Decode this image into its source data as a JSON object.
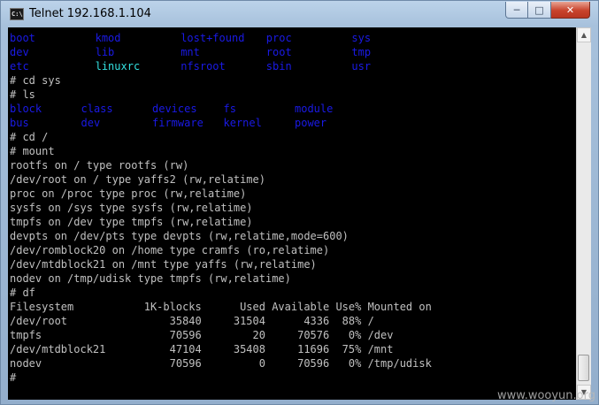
{
  "window": {
    "title": "Telnet 192.168.1.104",
    "icon_label": "C:\\",
    "buttons": {
      "minimize": "─",
      "maximize": "□",
      "close": "✕"
    }
  },
  "colors": {
    "directory": "#1a1ae6",
    "link": "#33e0e0",
    "text": "#c0c0c0",
    "background": "#000000"
  },
  "terminal": {
    "lines": [
      {
        "tokens": [
          {
            "text": "boot",
            "kind": "dir",
            "col": 0
          },
          {
            "text": "kmod",
            "kind": "dir",
            "col": 12
          },
          {
            "text": "lost+found",
            "kind": "dir",
            "col": 24
          },
          {
            "text": "proc",
            "kind": "dir",
            "col": 36
          },
          {
            "text": "sys",
            "kind": "dir",
            "col": 48
          }
        ]
      },
      {
        "tokens": [
          {
            "text": "dev",
            "kind": "dir",
            "col": 0
          },
          {
            "text": "lib",
            "kind": "dir",
            "col": 12
          },
          {
            "text": "mnt",
            "kind": "dir",
            "col": 24
          },
          {
            "text": "root",
            "kind": "dir",
            "col": 36
          },
          {
            "text": "tmp",
            "kind": "dir",
            "col": 48
          }
        ]
      },
      {
        "tokens": [
          {
            "text": "etc",
            "kind": "dir",
            "col": 0
          },
          {
            "text": "linuxrc",
            "kind": "link",
            "col": 12
          },
          {
            "text": "nfsroot",
            "kind": "dir",
            "col": 24
          },
          {
            "text": "sbin",
            "kind": "dir",
            "col": 36
          },
          {
            "text": "usr",
            "kind": "dir",
            "col": 48
          }
        ]
      },
      {
        "tokens": [
          {
            "text": "# cd sys",
            "kind": "text",
            "col": 0
          }
        ]
      },
      {
        "tokens": [
          {
            "text": "# ls",
            "kind": "text",
            "col": 0
          }
        ]
      },
      {
        "tokens": [
          {
            "text": "block",
            "kind": "dir",
            "col": 0
          },
          {
            "text": "class",
            "kind": "dir",
            "col": 10
          },
          {
            "text": "devices",
            "kind": "dir",
            "col": 20
          },
          {
            "text": "fs",
            "kind": "dir",
            "col": 30
          },
          {
            "text": "module",
            "kind": "dir",
            "col": 40
          }
        ]
      },
      {
        "tokens": [
          {
            "text": "bus",
            "kind": "dir",
            "col": 0
          },
          {
            "text": "dev",
            "kind": "dir",
            "col": 10
          },
          {
            "text": "firmware",
            "kind": "dir",
            "col": 20
          },
          {
            "text": "kernel",
            "kind": "dir",
            "col": 30
          },
          {
            "text": "power",
            "kind": "dir",
            "col": 40
          }
        ]
      },
      {
        "tokens": [
          {
            "text": "# cd /",
            "kind": "text",
            "col": 0
          }
        ]
      },
      {
        "tokens": [
          {
            "text": "# mount",
            "kind": "text",
            "col": 0
          }
        ]
      },
      {
        "tokens": [
          {
            "text": "rootfs on / type rootfs (rw)",
            "kind": "text",
            "col": 0
          }
        ]
      },
      {
        "tokens": [
          {
            "text": "/dev/root on / type yaffs2 (rw,relatime)",
            "kind": "text",
            "col": 0
          }
        ]
      },
      {
        "tokens": [
          {
            "text": "proc on /proc type proc (rw,relatime)",
            "kind": "text",
            "col": 0
          }
        ]
      },
      {
        "tokens": [
          {
            "text": "sysfs on /sys type sysfs (rw,relatime)",
            "kind": "text",
            "col": 0
          }
        ]
      },
      {
        "tokens": [
          {
            "text": "tmpfs on /dev type tmpfs (rw,relatime)",
            "kind": "text",
            "col": 0
          }
        ]
      },
      {
        "tokens": [
          {
            "text": "devpts on /dev/pts type devpts (rw,relatime,mode=600)",
            "kind": "text",
            "col": 0
          }
        ]
      },
      {
        "tokens": [
          {
            "text": "/dev/romblock20 on /home type cramfs (ro,relatime)",
            "kind": "text",
            "col": 0
          }
        ]
      },
      {
        "tokens": [
          {
            "text": "/dev/mtdblock21 on /mnt type yaffs (rw,relatime)",
            "kind": "text",
            "col": 0
          }
        ]
      },
      {
        "tokens": [
          {
            "text": "nodev on /tmp/udisk type tmpfs (rw,relatime)",
            "kind": "text",
            "col": 0
          }
        ]
      },
      {
        "tokens": [
          {
            "text": "# df",
            "kind": "text",
            "col": 0
          }
        ]
      },
      {
        "tokens": [
          {
            "text": "Filesystem           1K-blocks      Used Available Use% Mounted on",
            "kind": "text",
            "col": 0
          }
        ]
      },
      {
        "tokens": [
          {
            "text": "/dev/root                35840     31504      4336  88% /",
            "kind": "text",
            "col": 0
          }
        ]
      },
      {
        "tokens": [
          {
            "text": "tmpfs                    70596        20     70576   0% /dev",
            "kind": "text",
            "col": 0
          }
        ]
      },
      {
        "tokens": [
          {
            "text": "/dev/mtdblock21          47104     35408     11696  75% /mnt",
            "kind": "text",
            "col": 0
          }
        ]
      },
      {
        "tokens": [
          {
            "text": "nodev                    70596         0     70596   0% /tmp/udisk",
            "kind": "text",
            "col": 0
          }
        ]
      },
      {
        "tokens": [
          {
            "text": "#",
            "kind": "text",
            "col": 0
          }
        ]
      }
    ]
  },
  "scrollbar": {
    "up_arrow": "▲",
    "down_arrow": "▼"
  },
  "watermark": "www.wooyun.org"
}
